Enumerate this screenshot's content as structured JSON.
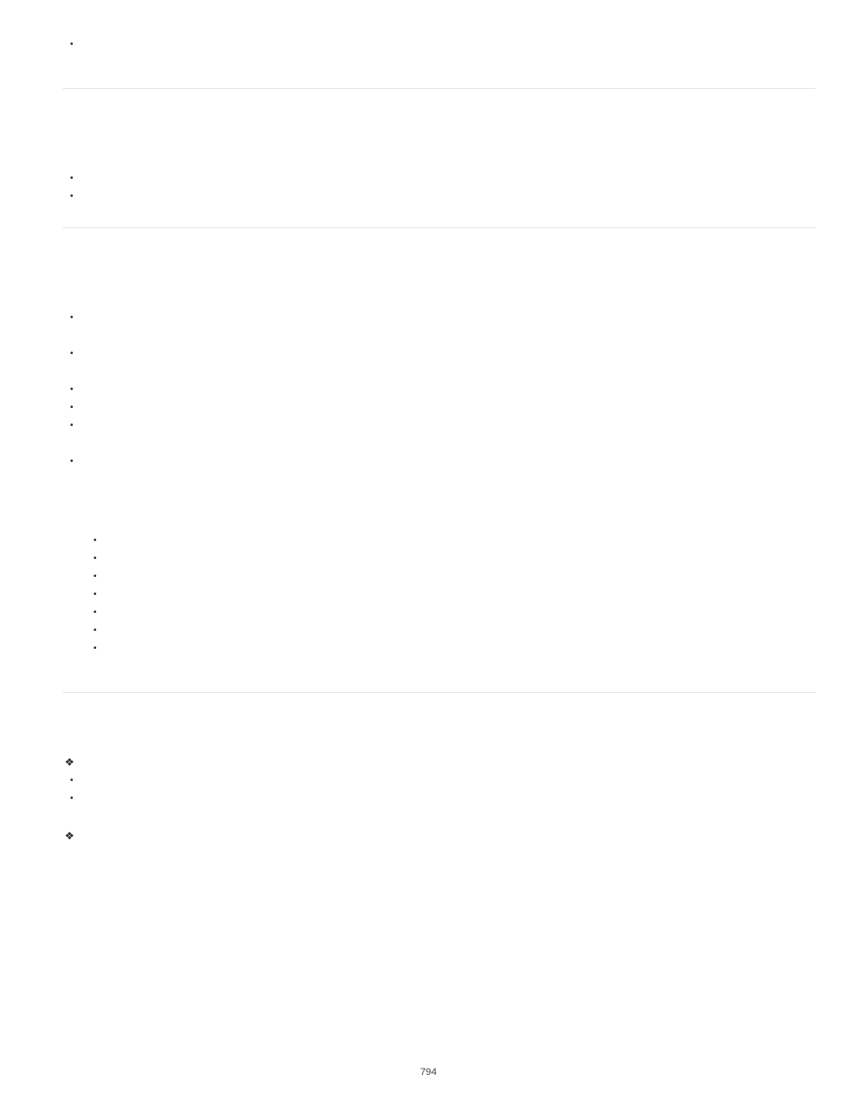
{
  "block1": {
    "items": [
      ""
    ]
  },
  "block2": {
    "items": [
      "",
      ""
    ]
  },
  "block3": {
    "outer": [
      "",
      "",
      "",
      "",
      "",
      ""
    ],
    "innerHeader": [
      ""
    ],
    "inner": [
      "",
      "",
      "",
      "",
      "",
      "",
      ""
    ]
  },
  "block4": {
    "diamond1": [
      ""
    ],
    "bullets1": [
      "",
      ""
    ],
    "diamond2": [
      ""
    ]
  },
  "pageNumber": "794"
}
